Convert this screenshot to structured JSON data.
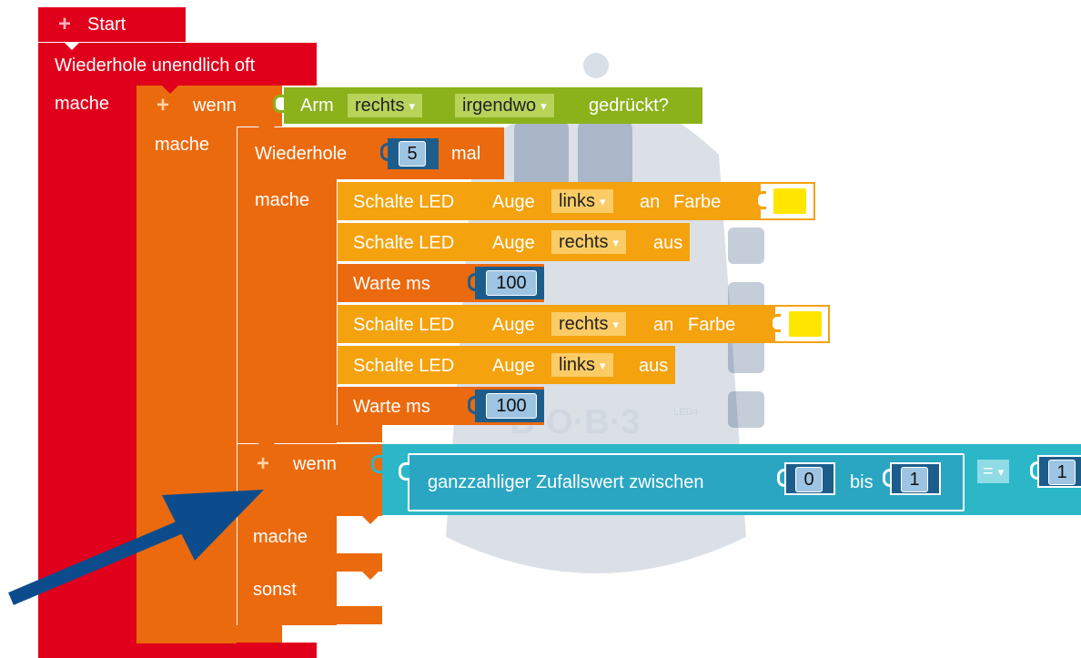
{
  "colors": {
    "event": "#e0001b",
    "control": "#eb6a0e",
    "action": "#f4a20e",
    "sensor": "#8bb11b",
    "math": "#2bb7c8",
    "arrow": "#0d4c8c",
    "led_color": "#ffe600"
  },
  "start": {
    "plus": "+",
    "label": "Start"
  },
  "forever": {
    "label": "Wiederhole unendlich oft",
    "mache": "mache"
  },
  "if1": {
    "plus": "+",
    "label": "wenn",
    "mache": "mache"
  },
  "sensor": {
    "label": "Arm",
    "side": "rechts",
    "where": "irgendwo",
    "suffix": "gedrückt?"
  },
  "repeat": {
    "label": "Wiederhole",
    "count": "5",
    "suffix": "mal",
    "mache": "mache"
  },
  "statements": [
    {
      "prefix": "Schalte LED",
      "eye": "Auge",
      "side": "links",
      "state": "an",
      "color_label": "Farbe"
    },
    {
      "prefix": "Schalte LED",
      "eye": "Auge",
      "side": "rechts",
      "state": "aus"
    },
    {
      "wait": "Warte ms",
      "value": "100"
    },
    {
      "prefix": "Schalte LED",
      "eye": "Auge",
      "side": "rechts",
      "state": "an",
      "color_label": "Farbe"
    },
    {
      "prefix": "Schalte LED",
      "eye": "Auge",
      "side": "links",
      "state": "aus"
    },
    {
      "wait": "Warte ms",
      "value": "100"
    }
  ],
  "if2": {
    "plus": "+",
    "label": "wenn",
    "mache": "mache",
    "sonst": "sonst"
  },
  "random": {
    "label": "ganzzahliger Zufallswert zwischen",
    "from": "0",
    "to_label": "bis",
    "to": "1",
    "op": "=",
    "compare": "1"
  },
  "dropdown_arrow": "▾",
  "background": {
    "logo_text": "B·O·B·3",
    "led_label": "LED4"
  }
}
